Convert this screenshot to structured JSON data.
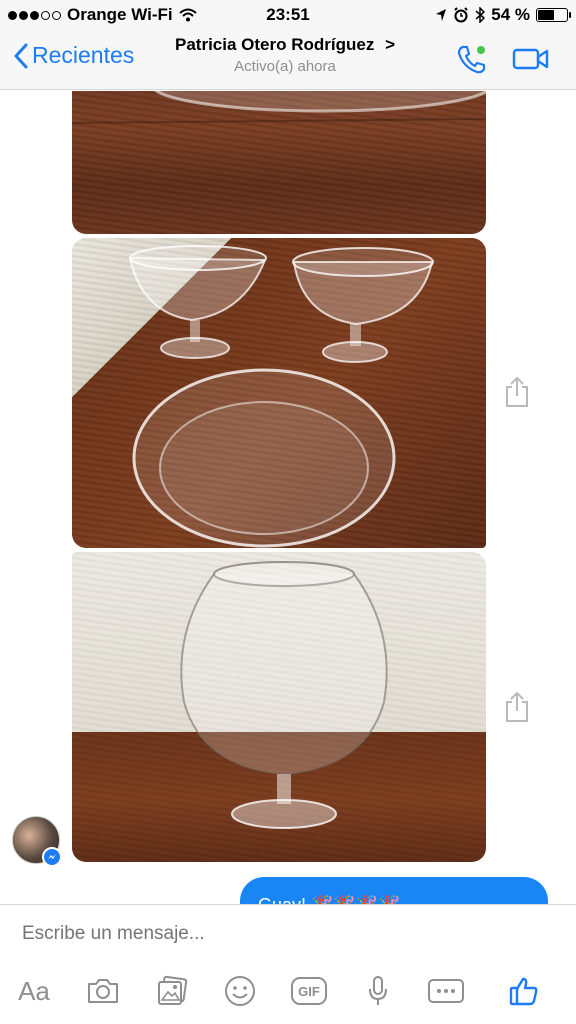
{
  "status_bar": {
    "carrier": "Orange Wi-Fi",
    "time": "23:51",
    "battery": "54 %",
    "battery_level": 0.54
  },
  "header": {
    "back_label": "Recientes",
    "contact_name": "Patricia Otero Rodríguez",
    "chevron": ">",
    "contact_status": "Activo(a) ahora"
  },
  "messages": {
    "outgoing_preview": "Guay! 🎉🎉🎉🎉",
    "photos": [
      {
        "icon": "photo-glass-bowl-top"
      },
      {
        "icon": "photo-dessert-glasses-and-bowl"
      },
      {
        "icon": "photo-brandy-snifter-vase"
      }
    ]
  },
  "composer": {
    "placeholder": "Escribe un mensaje...",
    "aa_label": "Aa",
    "gif_label": "GIF"
  },
  "colors": {
    "accent": "#1d7bf5",
    "bubble": "#1a86f5",
    "online": "#44c74a",
    "placeholder": "#a3a3a8"
  }
}
